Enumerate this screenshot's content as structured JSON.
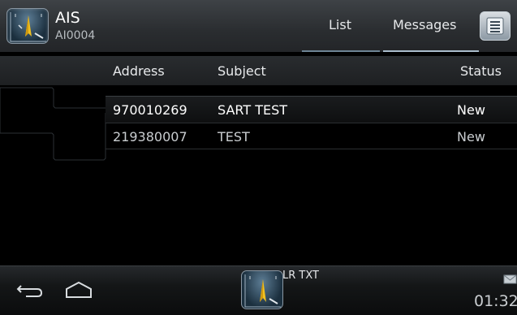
{
  "header": {
    "app_title": "AIS",
    "app_subtitle": "AI0004",
    "tabs": [
      {
        "label": "List",
        "active": false
      },
      {
        "label": "Messages",
        "active": true
      }
    ],
    "menu_icon": "list-menu-icon"
  },
  "table": {
    "columns": [
      "Address",
      "Subject",
      "Status"
    ],
    "rows": [
      {
        "address": "970010269",
        "subject": "SART TEST",
        "status": "New"
      },
      {
        "address": "219380007",
        "subject": "TEST",
        "status": "New"
      }
    ]
  },
  "bottom_bar": {
    "notification_label": "LR TXT",
    "clock": "01:32",
    "icons": [
      "back-icon",
      "home-icon",
      "ais-app-icon",
      "mail-icon"
    ]
  },
  "colors": {
    "header_bg": "#2a2d30",
    "background": "#000000",
    "tab_underline_active": "#a9bccb",
    "icon_blue": "#5d7d95"
  }
}
